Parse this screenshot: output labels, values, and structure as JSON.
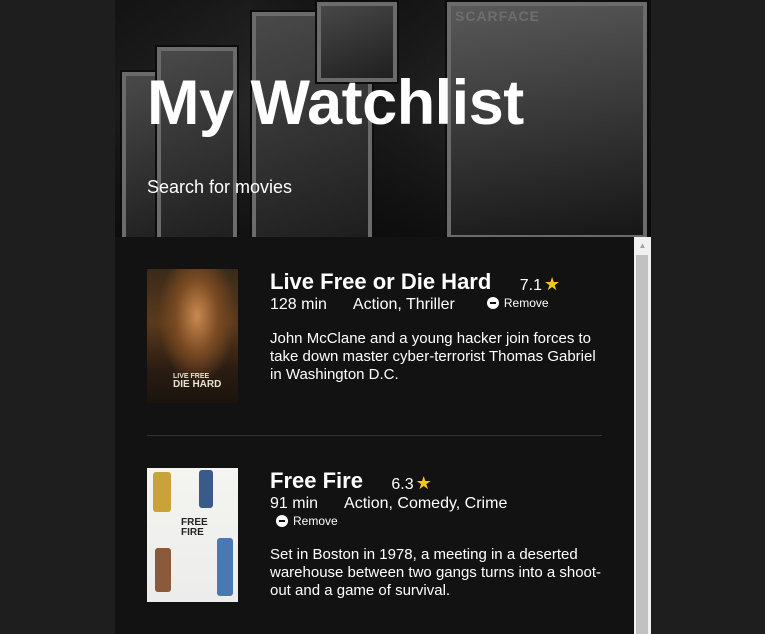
{
  "header": {
    "title": "My Watchlist",
    "search_placeholder": "Search for movies",
    "backdrop_poster_text": "SCARFACE"
  },
  "movies": [
    {
      "title": "Live Free or Die Hard",
      "rating": "7.1",
      "runtime": "128 min",
      "genres": "Action, Thriller",
      "remove_label": "Remove",
      "description": "John McClane and a young hacker join forces to take down master cyber-terrorist Thomas Gabriel in Washington D.C.",
      "poster_text_top": "LIVE FREE",
      "poster_text_bottom": "DIE HARD"
    },
    {
      "title": "Free Fire",
      "rating": "6.3",
      "runtime": "91 min",
      "genres": "Action, Comedy, Crime",
      "remove_label": "Remove",
      "description": "Set in Boston in 1978, a meeting in a deserted warehouse between two gangs turns into a shoot-out and a game of survival.",
      "poster_text_top": "FREE",
      "poster_text_bottom": "FIRE"
    }
  ],
  "icons": {
    "star": "star-icon",
    "remove": "minus-circle-icon"
  },
  "colors": {
    "page_bg": "#1e1e1e",
    "panel_bg": "#121212",
    "star": "#f5c518"
  }
}
